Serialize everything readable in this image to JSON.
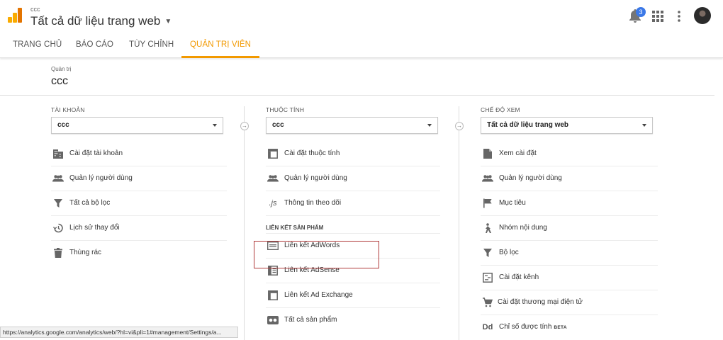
{
  "header": {
    "account": "ccc",
    "view_title": "Tất cả dữ liệu trang web",
    "notification_count": "3"
  },
  "nav": {
    "tabs": [
      "TRANG CHỦ",
      "BÁO CÁO",
      "TÙY CHỈNH",
      "QUẢN TRỊ VIÊN"
    ],
    "active": "QUẢN TRỊ VIÊN"
  },
  "breadcrumb": "Quản trị",
  "account_name": "ccc",
  "columns": {
    "account": {
      "label": "TÀI KHOẢN",
      "selected": "ccc",
      "items": [
        "Cài đặt tài khoản",
        "Quản lý người dùng",
        "Tất cả bộ lọc",
        "Lịch sử thay đổi",
        "Thùng rác"
      ]
    },
    "property": {
      "label": "THUỘC TÍNH",
      "selected": "ccc",
      "items": [
        "Cài đặt thuộc tính",
        "Quản lý người dùng",
        "Thông tin theo dõi"
      ],
      "section": "LIÊN KẾT SẢN PHẨM",
      "section_items": [
        "Liên kết AdWords",
        "Liên kết AdSense",
        "Liên kết Ad Exchange",
        "Tất cả sản phẩm"
      ]
    },
    "view": {
      "label": "CHẾ ĐỘ XEM",
      "selected": "Tất cả dữ liệu trang web",
      "items": [
        "Xem cài đặt",
        "Quản lý người dùng",
        "Mục tiêu",
        "Nhóm nội dung",
        "Bộ lọc",
        "Cài đặt kênh",
        "Cài đặt thương mại điện tử",
        "Chỉ số được tính"
      ],
      "beta_label": "BETA"
    }
  },
  "status_url": "https://analytics.google.com/analytics/web/?hl=vi&pli=1#management/Settings/a...",
  "colors": {
    "accent": "#f29900",
    "highlight_border": "#b03a3a",
    "badge": "#3b78e7"
  }
}
